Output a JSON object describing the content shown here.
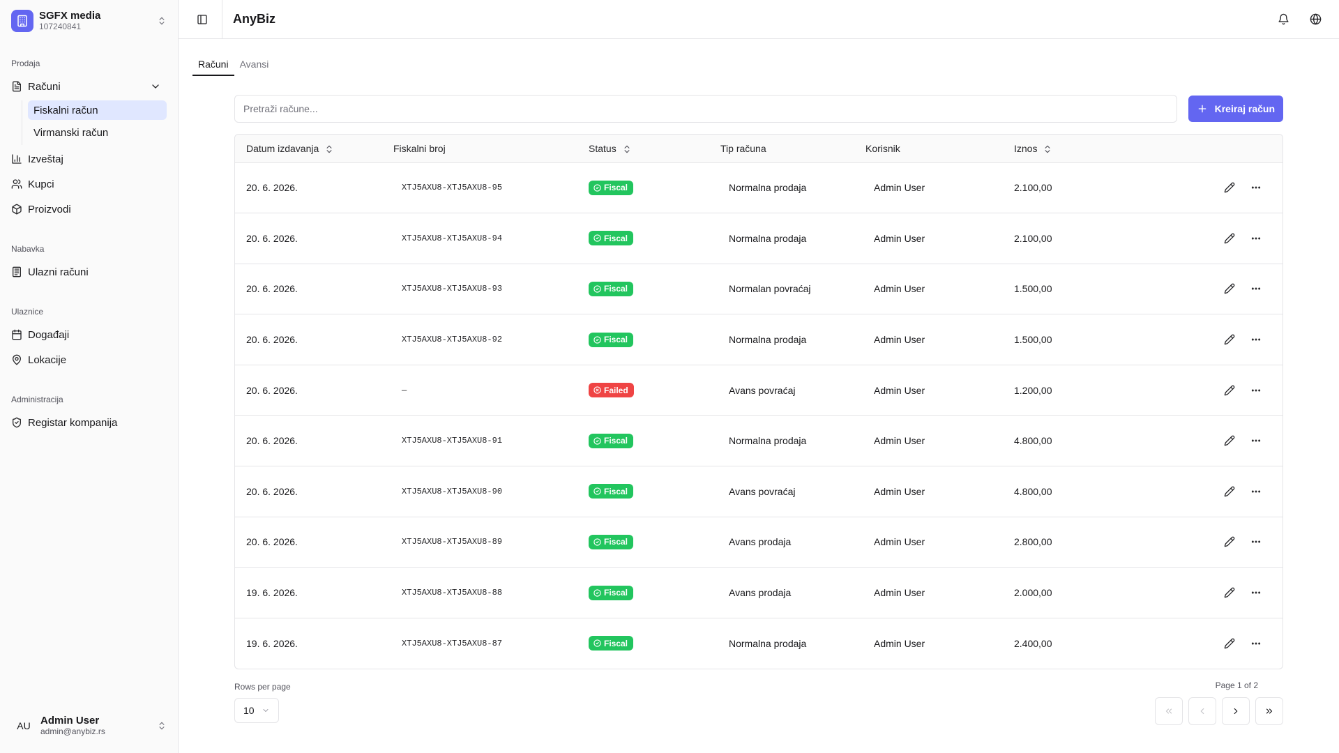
{
  "org": {
    "name": "SGFX media",
    "id": "107240841"
  },
  "nav": {
    "groups": [
      {
        "label": "Prodaja"
      },
      {
        "label": "Nabavka"
      },
      {
        "label": "Ulaznice"
      },
      {
        "label": "Administracija"
      }
    ],
    "racuni": {
      "label": "Računi",
      "icon": "file-text-icon"
    },
    "sub": [
      {
        "label": "Fiskalni račun",
        "active": true
      },
      {
        "label": "Virmanski račun",
        "active": false
      }
    ],
    "izvestaj": {
      "label": "Izveštaj",
      "icon": "bar-chart-icon"
    },
    "kupci": {
      "label": "Kupci",
      "icon": "users-icon"
    },
    "proizvodi": {
      "label": "Proizvodi",
      "icon": "package-icon"
    },
    "ulazni": {
      "label": "Ulazni računi",
      "icon": "receipt-icon"
    },
    "dogadjaji": {
      "label": "Događaji",
      "icon": "calendar-icon"
    },
    "lokacije": {
      "label": "Lokacije",
      "icon": "map-pin-icon"
    },
    "registar": {
      "label": "Registar kompanija",
      "icon": "shield-check-icon"
    }
  },
  "user": {
    "initials": "AU",
    "name": "Admin User",
    "email": "admin@anybiz.rs"
  },
  "header": {
    "title": "AnyBiz"
  },
  "tabs": [
    {
      "label": "Računi",
      "active": true
    },
    {
      "label": "Avansi",
      "active": false
    }
  ],
  "search": {
    "placeholder": "Pretraži račune...",
    "value": ""
  },
  "create_button": {
    "label": "Kreiraj račun"
  },
  "table": {
    "columns": [
      "Datum izdavanja",
      "Fiskalni broj",
      "Status",
      "Tip računa",
      "Korisnik",
      "Iznos"
    ],
    "rows": [
      {
        "date": "20. 6. 2026.",
        "number": "XTJ5AXU8-XTJ5AXU8-95",
        "status": "Fiscal",
        "type": "Normalna prodaja",
        "user": "Admin User",
        "amount": "2.100,00"
      },
      {
        "date": "20. 6. 2026.",
        "number": "XTJ5AXU8-XTJ5AXU8-94",
        "status": "Fiscal",
        "type": "Normalna prodaja",
        "user": "Admin User",
        "amount": "2.100,00"
      },
      {
        "date": "20. 6. 2026.",
        "number": "XTJ5AXU8-XTJ5AXU8-93",
        "status": "Fiscal",
        "type": "Normalan povraćaj",
        "user": "Admin User",
        "amount": "1.500,00"
      },
      {
        "date": "20. 6. 2026.",
        "number": "XTJ5AXU8-XTJ5AXU8-92",
        "status": "Fiscal",
        "type": "Normalna prodaja",
        "user": "Admin User",
        "amount": "1.500,00"
      },
      {
        "date": "20. 6. 2026.",
        "number": "—",
        "status": "Failed",
        "type": "Avans povraćaj",
        "user": "Admin User",
        "amount": "1.200,00"
      },
      {
        "date": "20. 6. 2026.",
        "number": "XTJ5AXU8-XTJ5AXU8-91",
        "status": "Fiscal",
        "type": "Normalna prodaja",
        "user": "Admin User",
        "amount": "4.800,00"
      },
      {
        "date": "20. 6. 2026.",
        "number": "XTJ5AXU8-XTJ5AXU8-90",
        "status": "Fiscal",
        "type": "Avans povraćaj",
        "user": "Admin User",
        "amount": "4.800,00"
      },
      {
        "date": "20. 6. 2026.",
        "number": "XTJ5AXU8-XTJ5AXU8-89",
        "status": "Fiscal",
        "type": "Avans prodaja",
        "user": "Admin User",
        "amount": "2.800,00"
      },
      {
        "date": "19. 6. 2026.",
        "number": "XTJ5AXU8-XTJ5AXU8-88",
        "status": "Fiscal",
        "type": "Avans prodaja",
        "user": "Admin User",
        "amount": "2.000,00"
      },
      {
        "date": "19. 6. 2026.",
        "number": "XTJ5AXU8-XTJ5AXU8-87",
        "status": "Fiscal",
        "type": "Normalna prodaja",
        "user": "Admin User",
        "amount": "2.400,00"
      }
    ]
  },
  "pagination": {
    "rows_per_page_label": "Rows per page",
    "rows_per_page": "10",
    "page_info": "Page 1 of 2"
  },
  "colors": {
    "accent": "#6366f1",
    "fiscal": "#22c55e",
    "failed": "#ef4444",
    "active_nav": "#e0e7ff"
  }
}
